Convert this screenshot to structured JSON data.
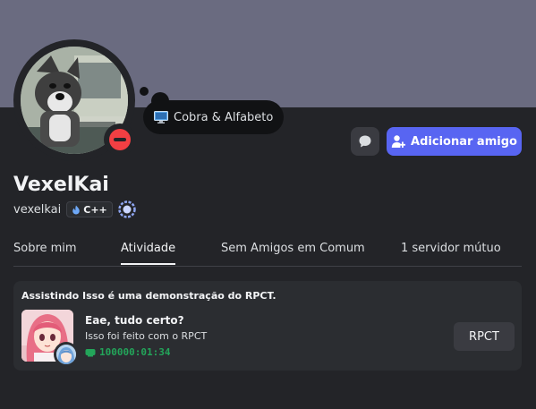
{
  "profile": {
    "display_name": "VexelKai",
    "username": "vexelkai",
    "status": "dnd",
    "custom_status": {
      "icon": "computer-icon",
      "text": "Cobra & Alfabeto"
    },
    "tag": {
      "icon": "flame-icon",
      "text": "C++"
    },
    "badges": [
      "nitro-style-badge-icon"
    ],
    "avatar_icon": "avatar-dog-at-computer"
  },
  "actions": {
    "message_icon": "chat-bubble-icon",
    "add_friend_label": "Adicionar amigo",
    "add_friend_icon": "add-user-icon"
  },
  "tabs": [
    {
      "label": "Sobre mim",
      "active": false
    },
    {
      "label": "Atividade",
      "active": true
    },
    {
      "label": "Sem Amigos em Comum",
      "active": false
    },
    {
      "label": "1 servidor mútuo",
      "active": false
    }
  ],
  "activity": {
    "header": "Assistindo Isso é uma demonstração do RPCT.",
    "details": "Eae, tudo certo?",
    "state": "Isso foi feito com o RPCT",
    "elapsed": "100000:01:34",
    "elapsed_icon": "controller-icon",
    "button_label": "RPCT"
  },
  "colors": {
    "banner": "#6a6b80",
    "background": "#232428",
    "card": "#2b2d31",
    "accent": "#5865f2",
    "dnd": "#f23f43",
    "timer": "#23a55a"
  }
}
